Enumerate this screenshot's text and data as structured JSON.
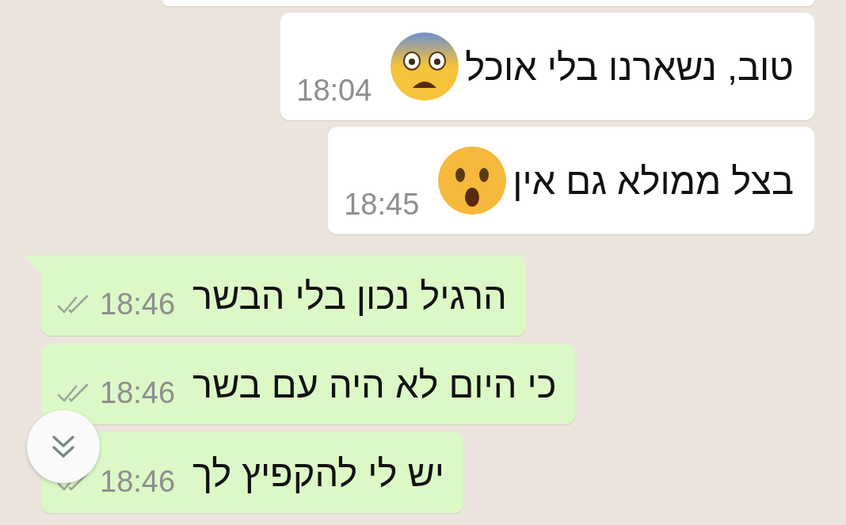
{
  "messages": [
    {
      "kind": "incoming",
      "text": "טוב, נשארנו בלי אוכל",
      "emoji": {
        "kind": "fearful"
      },
      "time": "18:04"
    },
    {
      "kind": "incoming",
      "text": "בצל ממולא גם אין",
      "emoji": {
        "kind": "astonished"
      },
      "time": "18:45"
    },
    {
      "kind": "outgoing",
      "text": "הרגיל נכון בלי הבשר",
      "time": "18:46",
      "read": true,
      "tail": true
    },
    {
      "kind": "outgoing",
      "text": "כי היום לא היה עם בשר",
      "time": "18:46",
      "read": true,
      "tail": false
    },
    {
      "kind": "outgoing",
      "text": "יש לי להקפיץ לך",
      "time": "18:46",
      "read": true,
      "tail": false
    }
  ]
}
